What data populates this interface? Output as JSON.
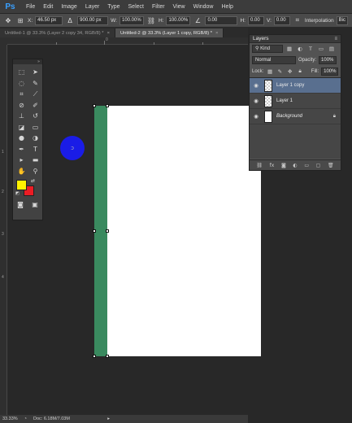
{
  "app": {
    "logo": "Ps"
  },
  "menu": [
    "File",
    "Edit",
    "Image",
    "Layer",
    "Type",
    "Select",
    "Filter",
    "View",
    "Window",
    "Help"
  ],
  "options": {
    "x_label": "X:",
    "x_value": "46.50 px",
    "w_label": "W:",
    "w_value": "100.00%",
    "h_label": "H:",
    "h_value": "100.00%",
    "y_value": "900.00 px",
    "angle_value": "0.00",
    "hskew_label": "H:",
    "hskew_value": "0.00",
    "vskew_label": "V:",
    "vskew_value": "0.00",
    "interp_label": "Interpolation",
    "interp_value": "Bic"
  },
  "tabs": [
    {
      "label": "Untitled-1 @ 33.3% (Layer 2 copy 34, RGB/8) *",
      "active": false
    },
    {
      "label": "Untitled-2 @ 33.3% (Layer 1 copy, RGB/8) *",
      "active": true
    }
  ],
  "ruler": {
    "left_marks": [
      "1",
      "2",
      "3",
      "4"
    ],
    "top_marks": [
      "0"
    ]
  },
  "layers_panel": {
    "title": "Layers",
    "kind": "Kind",
    "blend_mode": "Normal",
    "opacity_label": "Opacity:",
    "opacity_value": "100%",
    "lock_label": "Lock:",
    "fill_label": "Fill:",
    "fill_value": "100%",
    "layers": [
      {
        "name": "Layer 1 copy",
        "selected": true,
        "thumb": "checker"
      },
      {
        "name": "Layer 1",
        "selected": false,
        "thumb": "checker"
      },
      {
        "name": "Background",
        "selected": false,
        "thumb": "white",
        "locked": true
      }
    ]
  },
  "colors": {
    "foreground": "#fff200",
    "background": "#ec1c24",
    "accent_layer": "#3a8a5f",
    "brush_preview": "#1a1ce6"
  },
  "status": {
    "zoom": "33.33%",
    "doc": "Doc: 6.18M/7.03M"
  }
}
